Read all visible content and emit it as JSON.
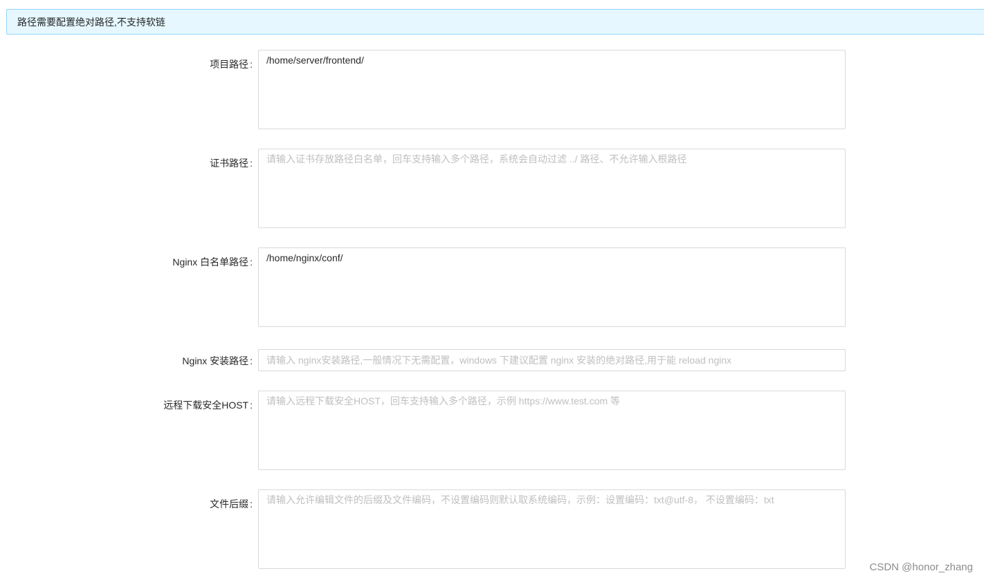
{
  "alert": {
    "message": "路径需要配置绝对路径,不支持软链"
  },
  "form": {
    "colon": ":",
    "fields": [
      {
        "label": "项目路径",
        "value": "/home/server/frontend/",
        "placeholder": ""
      },
      {
        "label": "证书路径",
        "value": "",
        "placeholder": "请输入证书存放路径白名单，回车支持输入多个路径，系统会自动过滤 ../ 路径、不允许输入根路径"
      },
      {
        "label": "Nginx 白名单路径",
        "value": "/home/nginx/conf/",
        "placeholder": ""
      },
      {
        "label": "Nginx 安装路径",
        "value": "",
        "placeholder": "请输入 nginx安装路径,一般情况下无需配置，windows 下建议配置 nginx 安装的绝对路径,用于能 reload nginx"
      },
      {
        "label": "远程下载安全HOST",
        "value": "",
        "placeholder": "请输入远程下载安全HOST，回车支持输入多个路径，示例 https://www.test.com 等"
      },
      {
        "label": "文件后缀",
        "value": "",
        "placeholder": "请输入允许编辑文件的后缀及文件编码，不设置编码则默认取系统编码，示例：设置编码：txt@utf-8， 不设置编码：txt"
      }
    ]
  },
  "watermark": {
    "text": "CSDN @honor_zhang"
  }
}
